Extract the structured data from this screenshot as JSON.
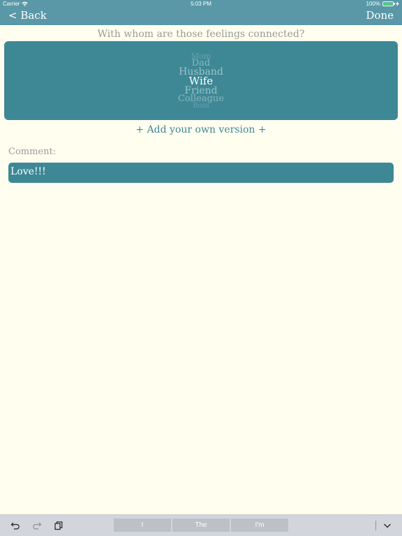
{
  "status_bar": {
    "carrier": "Carrier",
    "time": "5:03 PM",
    "battery_percent": "100%",
    "battery_level": 1.0,
    "battery_color": "#4cd964"
  },
  "nav": {
    "back_label": "< Back",
    "done_label": "Done",
    "background": "#5a98a7"
  },
  "question": "With whom are those feelings connected?",
  "picker": {
    "selected": "Wife",
    "items": [
      "Mom",
      "Dad",
      "Husband",
      "Wife",
      "Friend",
      "Colleague",
      "Boss"
    ],
    "background": "#3e8896"
  },
  "add_own_label": "+ Add your own version +",
  "comment": {
    "label": "Comment:",
    "value": "Love!!!"
  },
  "keyboard_bar": {
    "icons": [
      "undo-icon",
      "redo-icon",
      "paste-icon",
      "keyboard-dismiss-icon"
    ],
    "suggestions": [
      "I",
      "The",
      "I'm"
    ]
  }
}
